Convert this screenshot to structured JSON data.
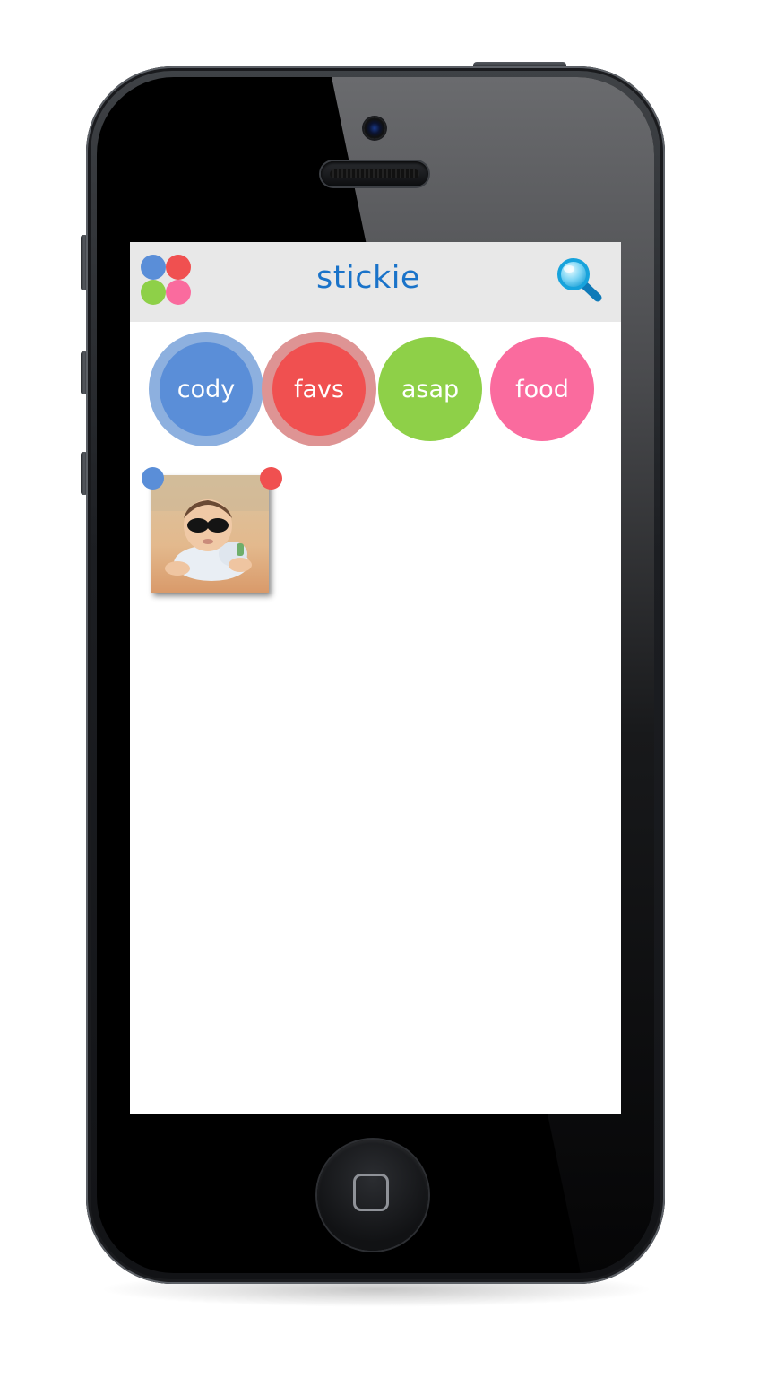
{
  "app": {
    "title": "stickie",
    "logo_icon": "app-logo-icon",
    "search_icon": "magnifier-icon"
  },
  "tags": [
    {
      "label": "cody",
      "color": "#5a8ed8",
      "ring": "#8db0df",
      "selected": true
    },
    {
      "label": "favs",
      "color": "#f05050",
      "ring": "#de9494",
      "selected": true
    },
    {
      "label": "asap",
      "color": "#8ed048",
      "selected": false
    },
    {
      "label": "food",
      "color": "#fa6b9e",
      "selected": false
    }
  ],
  "photos": [
    {
      "subject": "photo-thumbnail",
      "tag_colors": [
        "#5a8ed8",
        "#f05050"
      ]
    }
  ],
  "colors": {
    "header_bg": "#e8e8e8",
    "title": "#1a73c9",
    "logo": [
      "#5a8ed8",
      "#f05050",
      "#8ed048",
      "#fa6b9e"
    ]
  }
}
